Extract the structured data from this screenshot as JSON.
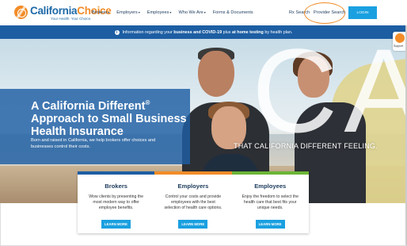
{
  "logo": {
    "part1": "California",
    "part2": "Choice",
    "tagline": "Your Health. Your Choice."
  },
  "nav": {
    "items": [
      {
        "label": "Brokers",
        "has_caret": true
      },
      {
        "label": "Employers",
        "has_caret": true
      },
      {
        "label": "Employees",
        "has_caret": true
      },
      {
        "label": "Who We Are",
        "has_caret": true
      },
      {
        "label": "Forms & Documents",
        "has_caret": false
      }
    ],
    "rx_search": "Rx Search",
    "provider_search": "Provider Search",
    "login": "LOGIN",
    "caret": "▾"
  },
  "infobar": {
    "icon": "i",
    "prefix": "Information regarding your ",
    "bold1": "business and COVID-19",
    "middle": " plus ",
    "bold2": "at home testing",
    "suffix": " by health plan."
  },
  "hero": {
    "title_part1": "A California Different",
    "title_sup": "®",
    "title_part2": " Approach to Small Business Health Insurance",
    "subtitle": "Born and raised in California, we help brokers offer choices and businesses control their costs.",
    "big_letters": "CA",
    "tagline": "THAT CALIFORNIA DIFFERENT FEELING."
  },
  "support": {
    "label": "Support"
  },
  "cards": [
    {
      "title": "Brokers",
      "text": "Wow clients by presenting the most modern way to offer employee benefits.",
      "button": "LEARN MORE",
      "color": "#1d5ea3"
    },
    {
      "title": "Employers",
      "text": "Control your costs and provide employees with the best selection of health care options.",
      "button": "LEARN MORE",
      "color": "#f28c28"
    },
    {
      "title": "Employees",
      "text": "Enjoy the freedom to select the health care that best fits your unique needs.",
      "button": "LEARN MORE",
      "color": "#6bb536"
    }
  ],
  "colors": {
    "brand_blue": "#1d5ea3",
    "brand_orange": "#f28c28",
    "button_blue": "#1aa0e0",
    "green": "#6bb536"
  }
}
